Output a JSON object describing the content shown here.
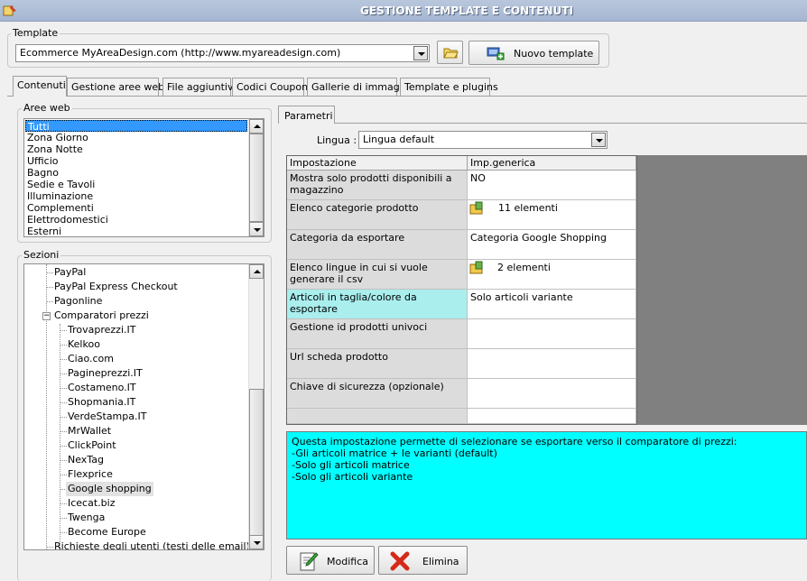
{
  "window": {
    "title": "GESTIONE TEMPLATE E CONTENUTI"
  },
  "template_group": {
    "label": "Template",
    "selected": "Ecommerce MyAreaDesign.com (http://www.myareadesign.com)",
    "new_button_label": "Nuovo template"
  },
  "tabs": [
    {
      "label": "Contenuti",
      "active": true
    },
    {
      "label": "Gestione aree web"
    },
    {
      "label": "File aggiuntivi"
    },
    {
      "label": "Codici Coupon"
    },
    {
      "label": "Gallerie di immagini"
    },
    {
      "label": "Template e plugins"
    }
  ],
  "aree_web": {
    "label": "Aree web",
    "items": [
      "Tutti",
      "Zona Giorno",
      "Zona Notte",
      "Ufficio",
      "Bagno",
      "Sedie e Tavoli",
      "Illuminazione",
      "Complementi",
      "Elettrodomestici",
      "Esterni"
    ]
  },
  "sezioni": {
    "label": "Sezioni",
    "items": [
      "PayPal",
      "PayPal Express Checkout",
      "Pagonline",
      "Comparatori prezzi",
      "Trovaprezzi.IT",
      "Kelkoo",
      "Ciao.com",
      "Pagineprezzi.IT",
      "Costameno.IT",
      "Shopmania.IT",
      "VerdeStampa.IT",
      "MrWallet",
      "ClickPoint",
      "NexTag",
      "Flexprice",
      "Google shopping",
      "Icecat.biz",
      "Twenga",
      "Become Europe",
      "Richieste degli utenti (testi delle email)"
    ],
    "expander": "−"
  },
  "parametri": {
    "tab_label": "Parametri",
    "lingua_label": "Lingua :",
    "lingua_value": "Lingua default",
    "grid": {
      "headers": [
        "Impostazione",
        "Imp.generica"
      ],
      "rows": [
        {
          "name": "Mostra solo prodotti disponibili a magazzino",
          "value": "NO"
        },
        {
          "name": "Elenco categorie prodotto",
          "value": "11 elementi",
          "icon": true
        },
        {
          "name": "Categoria da esportare",
          "value": "Categoria Google Shopping"
        },
        {
          "name": "Elenco lingue in cui si vuole generare il csv",
          "value": "2 elementi",
          "icon": true
        },
        {
          "name": "Articoli in taglia/colore da esportare",
          "value": "Solo articoli variante",
          "active": true
        },
        {
          "name": "Gestione id prodotti univoci",
          "value": ""
        },
        {
          "name": "Url scheda prodotto",
          "value": ""
        },
        {
          "name": "Chiave di sicurezza (opzionale)",
          "value": ""
        },
        {
          "name": "",
          "value": ""
        }
      ]
    },
    "description": [
      "Questa impostazione permette di selezionare se esportare verso il comparatore di prezzi:",
      "-Gli articoli matrice + le varianti (default)",
      "-Solo gli articoli matrice",
      "-Solo gli articoli variante"
    ]
  },
  "actions": {
    "modifica": "Modifica",
    "elimina": "Elimina"
  }
}
